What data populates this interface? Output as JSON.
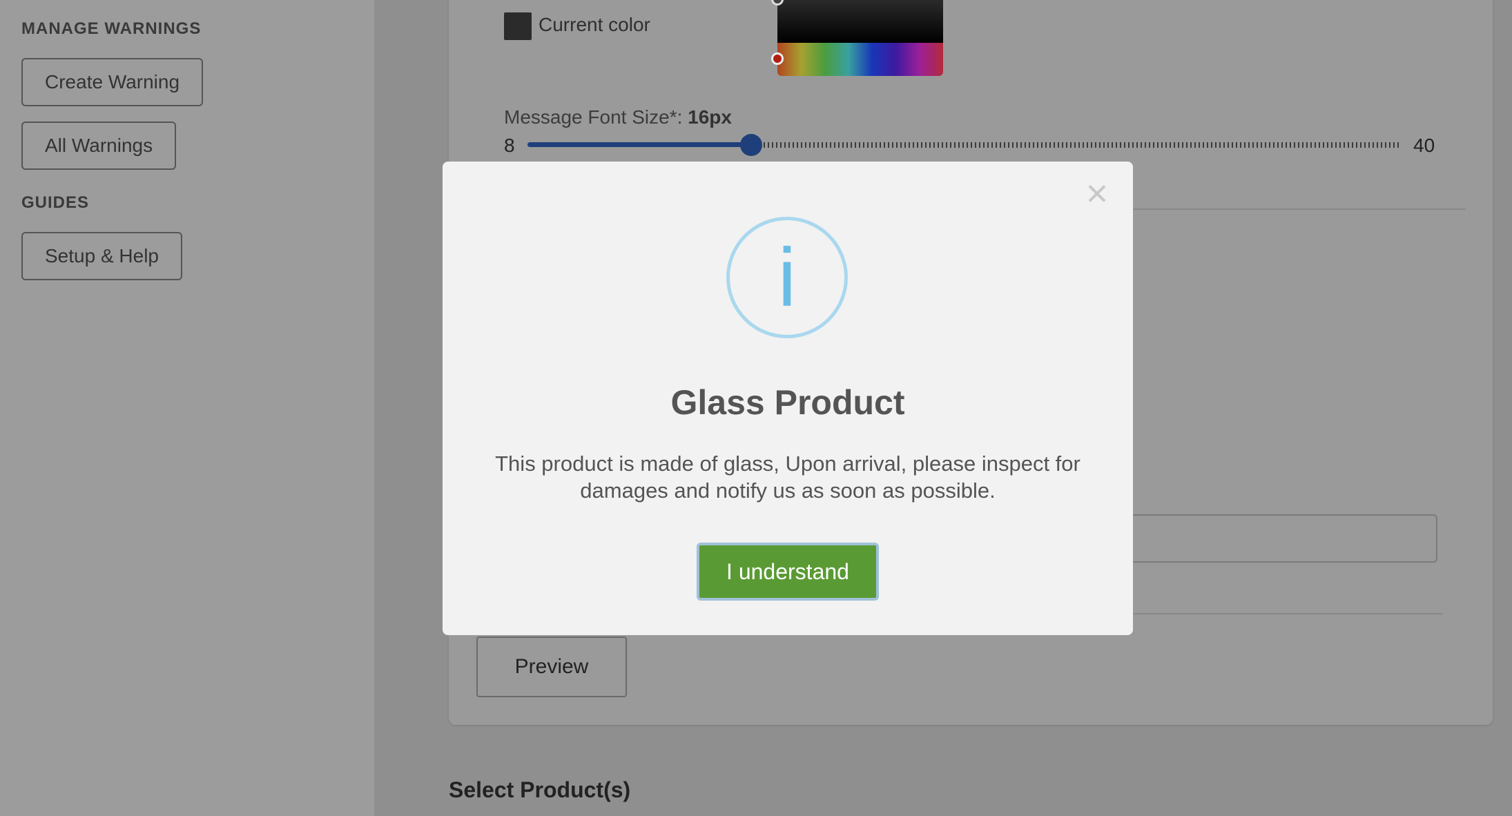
{
  "sidebar": {
    "manage_title": "MANAGE WARNINGS",
    "create_warning": "Create Warning",
    "all_warnings": "All Warnings",
    "guides_title": "GUIDES",
    "setup_help": "Setup & Help"
  },
  "settings": {
    "current_color_label": "Current color",
    "current_color": "#2b2b2b",
    "font_size_label": "Message Font Size*: ",
    "font_size_value": "16px",
    "slider": {
      "min": "8",
      "max": "40",
      "value": 16
    },
    "preview_button": "Preview",
    "select_products_heading": "Select Product(s)"
  },
  "modal": {
    "title": "Glass Product",
    "message": "This product is made of glass, Upon arrival, please inspect for damages and notify us as soon as possible.",
    "confirm_button": "I understand",
    "close_symbol": "×",
    "icon_glyph": "i",
    "icon_name": "info-icon",
    "confirm_color": "#5a9a34"
  }
}
